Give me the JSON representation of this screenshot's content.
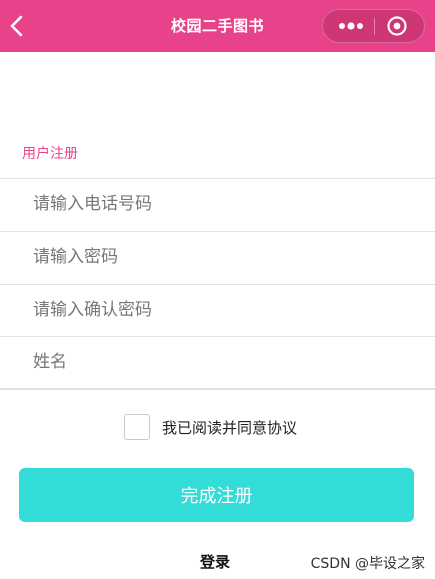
{
  "navbar": {
    "title": "校园二手图书",
    "back_icon": "chevron-left-icon",
    "more_icon": "more-dots-icon",
    "close_icon": "target-circle-icon",
    "background_color": "#e8438a"
  },
  "form": {
    "section_title": "用户注册",
    "fields": [
      {
        "name": "phone",
        "placeholder": "请输入电话号码",
        "value": ""
      },
      {
        "name": "password",
        "placeholder": "请输入密码",
        "value": ""
      },
      {
        "name": "confirm_password",
        "placeholder": "请输入确认密码",
        "value": ""
      },
      {
        "name": "full_name",
        "placeholder": "姓名",
        "value": ""
      }
    ],
    "agreement_label": "我已阅读并同意协议",
    "agreement_checked": false,
    "submit_label": "完成注册",
    "submit_color": "#34dcd8",
    "login_link": "登录"
  },
  "watermark": "CSDN @毕设之家",
  "colors": {
    "accent": "#e8438a",
    "button": "#34dcd8"
  }
}
